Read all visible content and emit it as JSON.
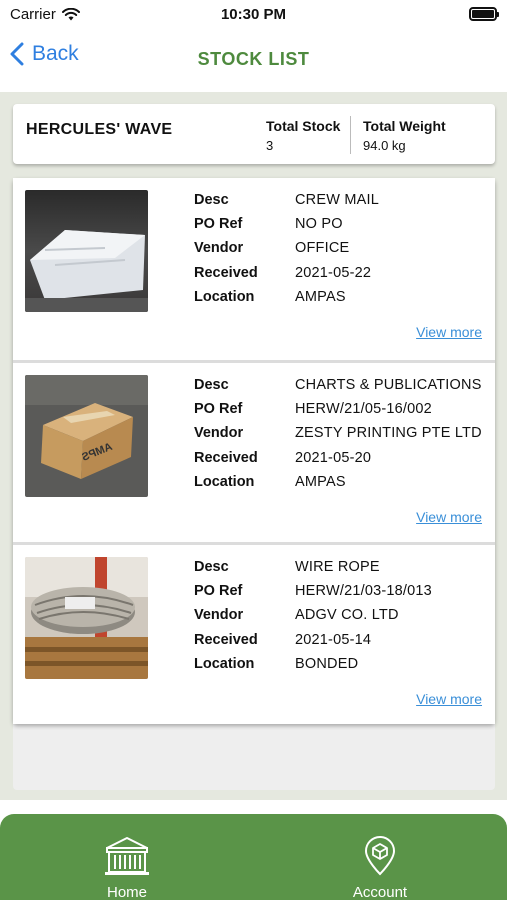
{
  "status_bar": {
    "carrier": "Carrier",
    "time": "10:30 PM"
  },
  "nav": {
    "back_label": "Back",
    "title": "STOCK LIST"
  },
  "summary": {
    "vessel_name": "HERCULES' WAVE",
    "total_stock_label": "Total Stock",
    "total_stock_value": "3",
    "total_weight_label": "Total Weight",
    "total_weight_value": "94.0 kg"
  },
  "field_labels": {
    "desc": "Desc",
    "po_ref": "PO Ref",
    "vendor": "Vendor",
    "received": "Received",
    "location": "Location"
  },
  "items": [
    {
      "desc": "CREW MAIL",
      "po_ref": "NO PO",
      "vendor": "OFFICE",
      "received": "2021-05-22",
      "location": "AMPAS",
      "view_more": "View more",
      "photo_icon": "white-parcel-photo"
    },
    {
      "desc": "CHARTS & PUBLICATIONS",
      "po_ref": "HERW/21/05-16/002",
      "vendor": "ZESTY PRINTING PTE LTD",
      "received": "2021-05-20",
      "location": "AMPAS",
      "view_more": "View more",
      "photo_icon": "cardboard-box-photo",
      "photo_box_text": "AMPS"
    },
    {
      "desc": "WIRE ROPE",
      "po_ref": "HERW/21/03-18/013",
      "vendor": "ADGV CO. LTD",
      "received": "2021-05-14",
      "location": "BONDED",
      "view_more": "View more",
      "photo_icon": "wire-rope-coil-photo"
    }
  ],
  "tabs": [
    {
      "label": "Home",
      "icon": "warehouse-icon"
    },
    {
      "label": "Account",
      "icon": "location-pin-icon"
    }
  ],
  "colors": {
    "accent_green": "#5a9448",
    "title_green": "#4e8a3e",
    "link_blue": "#3a8fd8",
    "back_blue": "#2f7fe0",
    "content_bg": "#e5e8df"
  }
}
